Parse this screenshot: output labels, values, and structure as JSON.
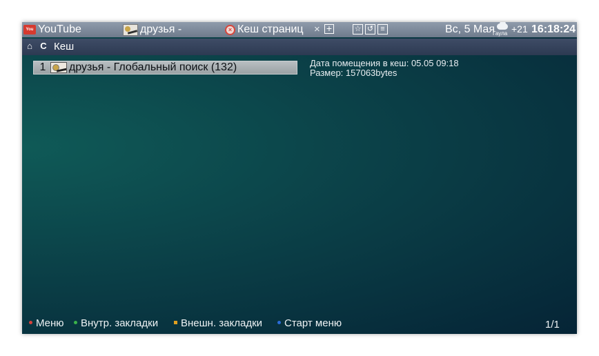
{
  "tabs": [
    {
      "label": "YouTube",
      "icon": "youtube-icon"
    },
    {
      "label": "друзья -",
      "icon": "friends-icon"
    },
    {
      "label": "Кеш страниц",
      "icon": "error-icon",
      "active": true
    }
  ],
  "toolbar": {
    "close_glyph": "×",
    "add_glyph": "+",
    "star_glyph": "☆",
    "back_glyph": "↺",
    "menu_glyph": "≡"
  },
  "status": {
    "date": "Вс, 5 Мая",
    "weather_icon": "cloud-icon",
    "weather_city": "Гаула",
    "temperature": "+21",
    "time": "16:18:24"
  },
  "nav": {
    "home_glyph": "⌂",
    "refresh_glyph": "C",
    "title": "Кеш"
  },
  "cache_list": [
    {
      "index": "1",
      "title": "друзья - Глобальный поиск (132)",
      "icon": "friends-icon"
    }
  ],
  "details": {
    "date_line": "Дата помещения в кеш: 05.05 09:18",
    "size_line": "Размер: 157063bytes"
  },
  "footer": {
    "menu": "Меню",
    "internal_bookmarks": "Внутр. закладки",
    "external_bookmarks": "Внешн. закладки",
    "start_menu": "Старт меню",
    "page_indicator": "1/1"
  },
  "colors": {
    "menu_key": "#d8423b",
    "internal_key": "#3bb34a",
    "external_key": "#e0a020",
    "start_key": "#2a6bd8"
  }
}
